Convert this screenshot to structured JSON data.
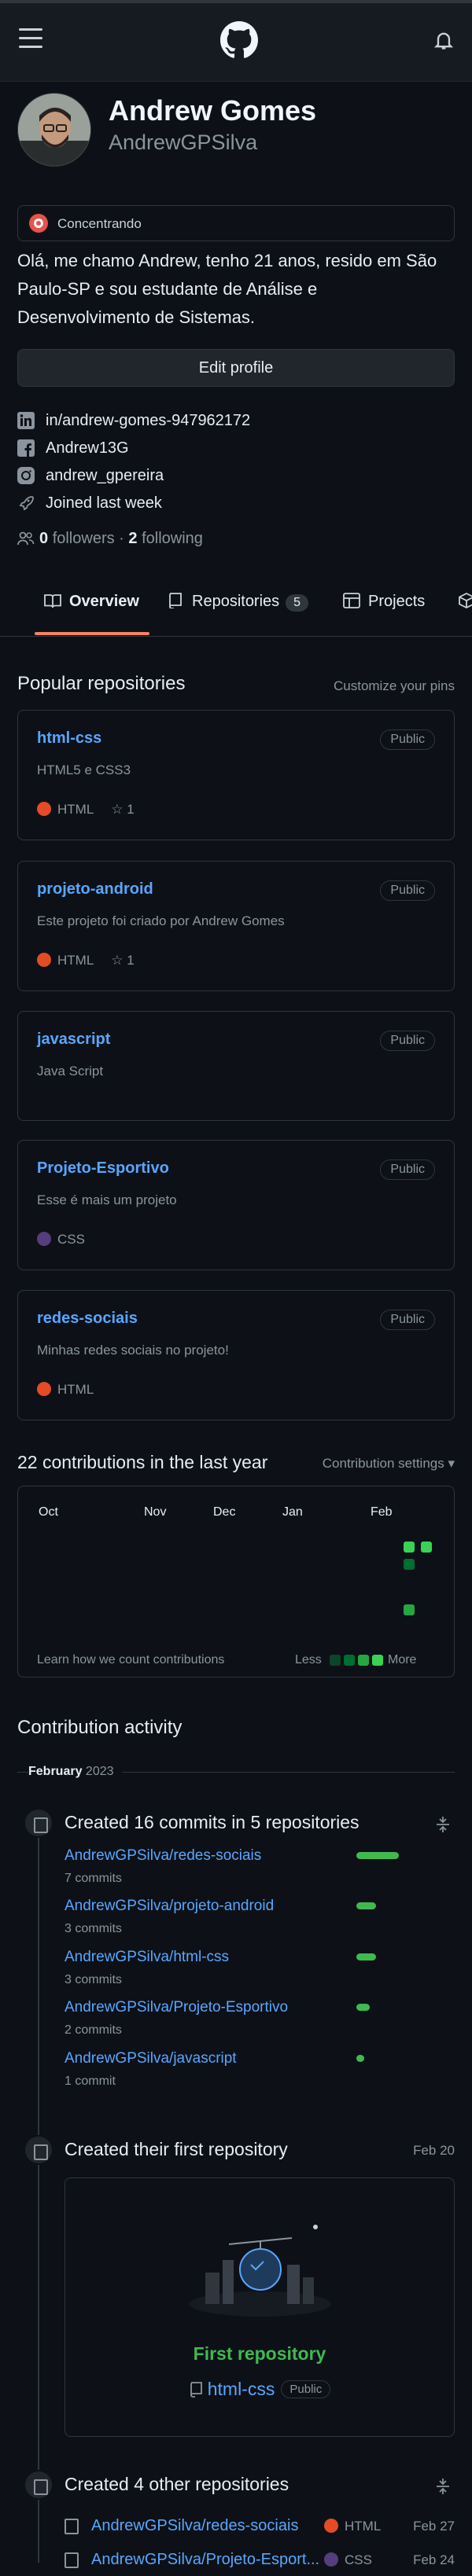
{
  "profile": {
    "name": "Andrew Gomes",
    "login": "AndrewGPSilva",
    "status": "Concentrando",
    "bio": "Olá, me chamo Andrew, tenho 21 anos, resido em São Paulo-SP e sou estudante de Análise e Desenvolvimento de Sistemas.",
    "edit_button": "Edit profile",
    "linkedin": "in/andrew-gomes-947962172",
    "facebook": "Andrew13G",
    "instagram": "andrew_gpereira",
    "joined": "Joined last week",
    "followers_count": "0",
    "followers_label": "followers",
    "separator": "·",
    "following_count": "2",
    "following_label": "following"
  },
  "tabs": {
    "overview": "Overview",
    "repositories": "Repositories",
    "repositories_count": "5",
    "projects": "Projects"
  },
  "popular": {
    "title": "Popular repositories",
    "customize": "Customize your pins",
    "repos": [
      {
        "name": "html-css",
        "visibility": "Public",
        "desc": "HTML5 e CSS3",
        "lang": "HTML",
        "lang_color": "#e34c26",
        "stars": "1"
      },
      {
        "name": "projeto-android",
        "visibility": "Public",
        "desc": "Este projeto foi criado por Andrew Gomes",
        "lang": "HTML",
        "lang_color": "#e34c26",
        "stars": "1"
      },
      {
        "name": "javascript",
        "visibility": "Public",
        "desc": "Java Script"
      },
      {
        "name": "Projeto-Esportivo",
        "visibility": "Public",
        "desc": "Esse é mais um projeto",
        "lang": "CSS",
        "lang_color": "#563d7c"
      },
      {
        "name": "redes-sociais",
        "visibility": "Public",
        "desc": "Minhas redes sociais no projeto!",
        "lang": "HTML",
        "lang_color": "#e34c26"
      }
    ]
  },
  "contributions": {
    "title": "22 contributions in the last year",
    "settings": "Contribution settings ▾",
    "months": [
      "Oct",
      "Nov",
      "Dec",
      "Jan",
      "Feb"
    ],
    "learn": "Learn how we count contributions",
    "less": "Less",
    "more": "More"
  },
  "activity": {
    "title": "Contribution activity",
    "month": "February",
    "year": "2023",
    "commits_title": "Created 16 commits in 5 repositories",
    "commits": [
      {
        "repo": "AndrewGPSilva/redes-sociais",
        "count": "7 commits"
      },
      {
        "repo": "AndrewGPSilva/projeto-android",
        "count": "3 commits"
      },
      {
        "repo": "AndrewGPSilva/html-css",
        "count": "3 commits"
      },
      {
        "repo": "AndrewGPSilva/Projeto-Esportivo",
        "count": "2 commits"
      },
      {
        "repo": "AndrewGPSilva/javascript",
        "count": "1 commit"
      }
    ],
    "first_title": "Created their first repository",
    "first_date": "Feb 20",
    "first_label": "First repository",
    "first_repo": "html-css",
    "first_visibility": "Public",
    "other_title": "Created 4 other repositories",
    "other": [
      {
        "repo": "AndrewGPSilva/redes-sociais",
        "lang": "HTML",
        "lang_color": "#e34c26",
        "date": "Feb 27"
      },
      {
        "repo": "AndrewGPSilva/Projeto-Esport...",
        "lang": "CSS",
        "lang_color": "#563d7c",
        "date": "Feb 24"
      }
    ]
  },
  "colors": {
    "accent": "#58a6ff",
    "tab_underline": "#f78166",
    "green": "#3fb950"
  }
}
